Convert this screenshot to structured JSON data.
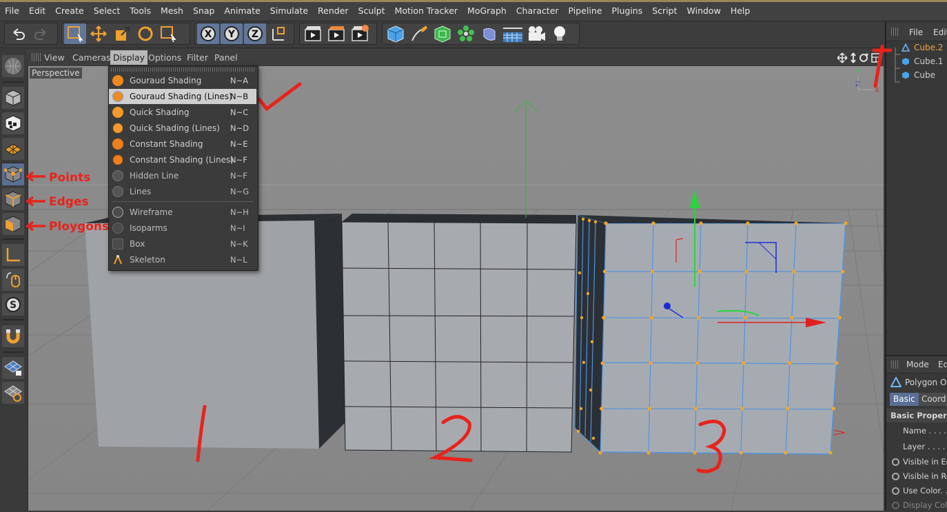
{
  "menubar": {
    "items": [
      "File",
      "Edit",
      "Create",
      "Select",
      "Tools",
      "Mesh",
      "Snap",
      "Animate",
      "Simulate",
      "Render",
      "Sculpt",
      "Motion Tracker",
      "MoGraph",
      "Character",
      "Pipeline",
      "Plugins",
      "Script",
      "Window",
      "Help"
    ]
  },
  "viewport_menu": {
    "items": [
      "View",
      "Cameras",
      "Display",
      "Options",
      "Filter",
      "Panel"
    ],
    "active": "Display",
    "camera_label": "Perspective"
  },
  "display_menu": {
    "items": [
      {
        "label": "Gouraud Shading",
        "shortcut": "N~A",
        "icon": "gouraud-icon"
      },
      {
        "label": "Gouraud Shading (Lines)",
        "shortcut": "N~B",
        "icon": "gouraud-lines-icon",
        "highlighted": true
      },
      {
        "label": "Quick Shading",
        "shortcut": "N~C",
        "icon": "quick-icon"
      },
      {
        "label": "Quick Shading (Lines)",
        "shortcut": "N~D",
        "icon": "quick-lines-icon"
      },
      {
        "label": "Constant Shading",
        "shortcut": "N~E",
        "icon": "constant-icon"
      },
      {
        "label": "Constant Shading (Lines)",
        "shortcut": "N~F",
        "icon": "constant-lines-icon"
      },
      {
        "label": "Hidden Line",
        "shortcut": "N~F",
        "icon": "hidden-line-icon"
      },
      {
        "label": "Lines",
        "shortcut": "N~G",
        "icon": "lines-icon"
      },
      {
        "label": "Wireframe",
        "shortcut": "N~H",
        "icon": "wireframe-icon"
      },
      {
        "label": "Isoparms",
        "shortcut": "N~I",
        "icon": "isoparms-icon"
      },
      {
        "label": "Box",
        "shortcut": "N~K",
        "icon": "box-icon"
      },
      {
        "label": "Skeleton",
        "shortcut": "N~L",
        "icon": "skeleton-icon"
      }
    ]
  },
  "object_manager": {
    "menu": [
      "File",
      "Edit"
    ],
    "objects": [
      {
        "name": "Cube.2",
        "selected": true
      },
      {
        "name": "Cube.1",
        "selected": false
      },
      {
        "name": "Cube",
        "selected": false
      }
    ]
  },
  "attributes": {
    "menu": [
      "Mode",
      "Edi"
    ],
    "object_type": "Polygon Ol",
    "tabs": [
      "Basic",
      "Coord."
    ],
    "section": "Basic Propertie",
    "fields": [
      "Name . . . . .",
      "Layer . . . . ."
    ],
    "options": [
      "Visible in Edi",
      "Visible in Rer",
      "Use Color. . .",
      "Display Colo"
    ]
  },
  "annotations": {
    "points": "Points",
    "edges": "Edges",
    "polygons": "Ploygons",
    "num1": "1",
    "num2": "2",
    "num3": "3"
  },
  "colors": {
    "accent_orange": "#f0a030",
    "selection_blue": "#62769a",
    "annotation_red": "#e8231c",
    "viewport_bg": "#8c8c8c"
  }
}
